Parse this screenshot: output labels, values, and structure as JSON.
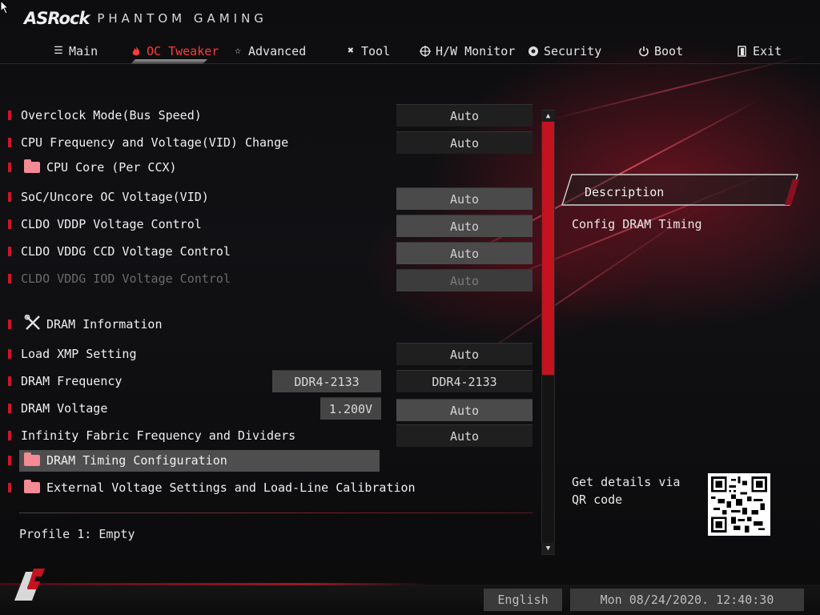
{
  "header": {
    "brand": "ASRock",
    "subtitle": "PHANTOM GAMING"
  },
  "nav": [
    {
      "label": "Main",
      "icon": "list-icon"
    },
    {
      "label": "OC Tweaker",
      "icon": "flame-icon",
      "active": true
    },
    {
      "label": "Advanced",
      "icon": "star-icon"
    },
    {
      "label": "Tool",
      "icon": "tools-icon"
    },
    {
      "label": "H/W Monitor",
      "icon": "target-icon"
    },
    {
      "label": "Security",
      "icon": "shield-icon"
    },
    {
      "label": "Boot",
      "icon": "power-icon"
    },
    {
      "label": "Exit",
      "icon": "exit-icon"
    }
  ],
  "settings": [
    {
      "label": "Overclock Mode(Bus Speed)",
      "value": "Auto"
    },
    {
      "label": "CPU Frequency and Voltage(VID) Change",
      "value": "Auto"
    },
    {
      "label": "CPU Core (Per CCX)"
    },
    {
      "label": "SoC/Uncore OC Voltage(VID)",
      "value": "Auto"
    },
    {
      "label": "CLDO VDDP Voltage Control",
      "value": "Auto"
    },
    {
      "label": "CLDO VDDG CCD Voltage Control",
      "value": "Auto"
    },
    {
      "label": "CLDO VDDG IOD Voltage Control",
      "value": "Auto",
      "disabled": true
    },
    {
      "label": "DRAM Information"
    },
    {
      "label": "Load XMP Setting",
      "value": "Auto"
    },
    {
      "label": "DRAM Frequency",
      "current": "DDR4-2133",
      "value": "DDR4-2133"
    },
    {
      "label": "DRAM Voltage",
      "current": "1.200V",
      "value": "Auto"
    },
    {
      "label": "Infinity Fabric Frequency and Dividers",
      "value": "Auto"
    },
    {
      "label": "DRAM Timing Configuration",
      "selected": true
    },
    {
      "label": "External Voltage Settings and Load-Line Calibration"
    }
  ],
  "profile": "Profile 1: Empty",
  "description": {
    "title": "Description",
    "text": "Config DRAM Timing"
  },
  "qr": {
    "text": "Get details via QR code"
  },
  "footer": {
    "language": "English",
    "datetime": "Mon 08/24/2020. 12:40:30"
  },
  "colors": {
    "accent": "#d0142a",
    "active_tab": "#ff3a3a",
    "folder": "#f48a93"
  }
}
